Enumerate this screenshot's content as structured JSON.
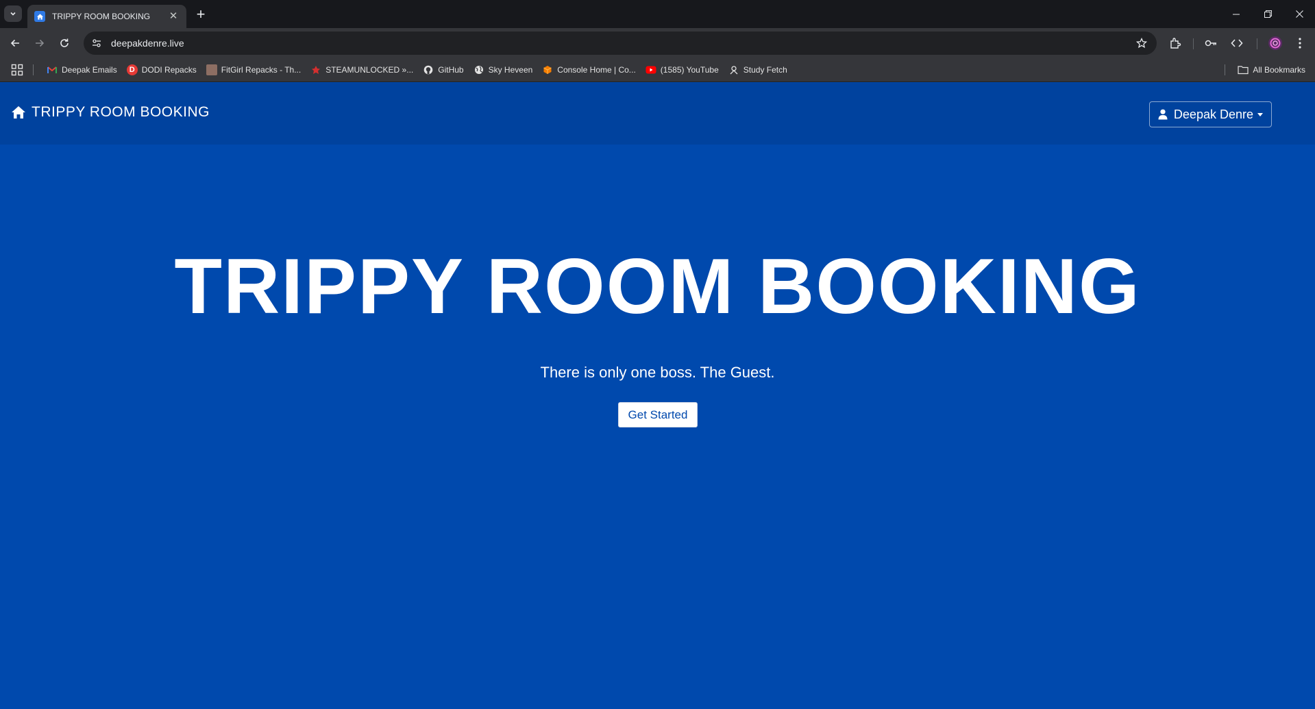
{
  "browser": {
    "tab": {
      "title": "TRIPPY ROOM BOOKING"
    },
    "address_bar": {
      "url": "deepakdenre.live"
    },
    "bookmarks": [
      {
        "label": "Deepak Emails",
        "icon": "gmail-icon",
        "color": "#ea4335"
      },
      {
        "label": "DODI Repacks",
        "icon": "dodi-icon",
        "color": "#e53935"
      },
      {
        "label": "FitGirl Repacks - Th...",
        "icon": "fitgirl-icon",
        "color": "#8d6e63"
      },
      {
        "label": "STEAMUNLOCKED »...",
        "icon": "steam-icon",
        "color": "#d32f2f"
      },
      {
        "label": "GitHub",
        "icon": "github-icon",
        "color": "#e3e3e3"
      },
      {
        "label": "Sky Heveen",
        "icon": "globe-icon",
        "color": "#e3e3e3"
      },
      {
        "label": "Console Home | Co...",
        "icon": "aws-icon",
        "color": "#f57c00"
      },
      {
        "label": "(1585) YouTube",
        "icon": "youtube-icon",
        "color": "#ff0000"
      },
      {
        "label": "Study Fetch",
        "icon": "studyfetch-icon",
        "color": "#e3e3e3"
      }
    ],
    "all_bookmarks_label": "All Bookmarks"
  },
  "site": {
    "brand": "TRIPPY ROOM BOOKING",
    "user_menu_label": "Deepak Denre",
    "hero": {
      "title": "TRIPPY ROOM BOOKING",
      "subtitle": "There is only one boss. The Guest.",
      "cta_label": "Get Started"
    },
    "colors": {
      "primary": "#0049ad",
      "navbar": "#00429e",
      "text": "#ffffff"
    }
  }
}
